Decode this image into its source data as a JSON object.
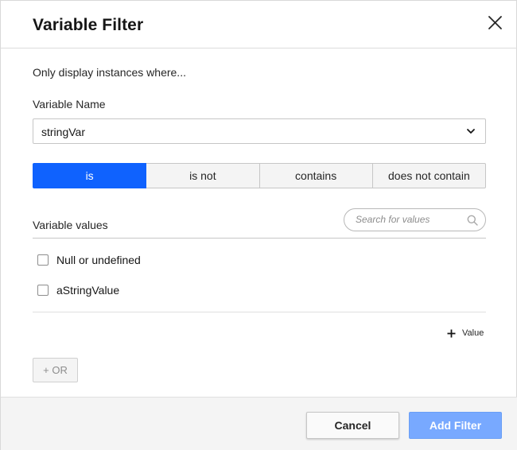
{
  "dialog": {
    "title": "Variable Filter",
    "intro": "Only display instances where...",
    "close_icon": "close-icon"
  },
  "variable": {
    "label": "Variable Name",
    "selected": "stringVar",
    "chevron_icon": "chevron-down-icon"
  },
  "operators": {
    "items": [
      "is",
      "is not",
      "contains",
      "does not contain"
    ],
    "active": "is"
  },
  "values": {
    "label": "Variable values",
    "search_placeholder": "Search for values",
    "search_icon": "search-icon",
    "options": [
      "Null or undefined",
      "aStringValue"
    ],
    "add_value_label": "Value",
    "add_value_icon": "plus-icon"
  },
  "or_button": {
    "label": "+ OR"
  },
  "footer": {
    "cancel_label": "Cancel",
    "add_filter_label": "Add Filter"
  },
  "colors": {
    "accent": "#0f62fe",
    "primary_disabled": "#78a9ff",
    "footer_bg": "#f4f4f4"
  }
}
